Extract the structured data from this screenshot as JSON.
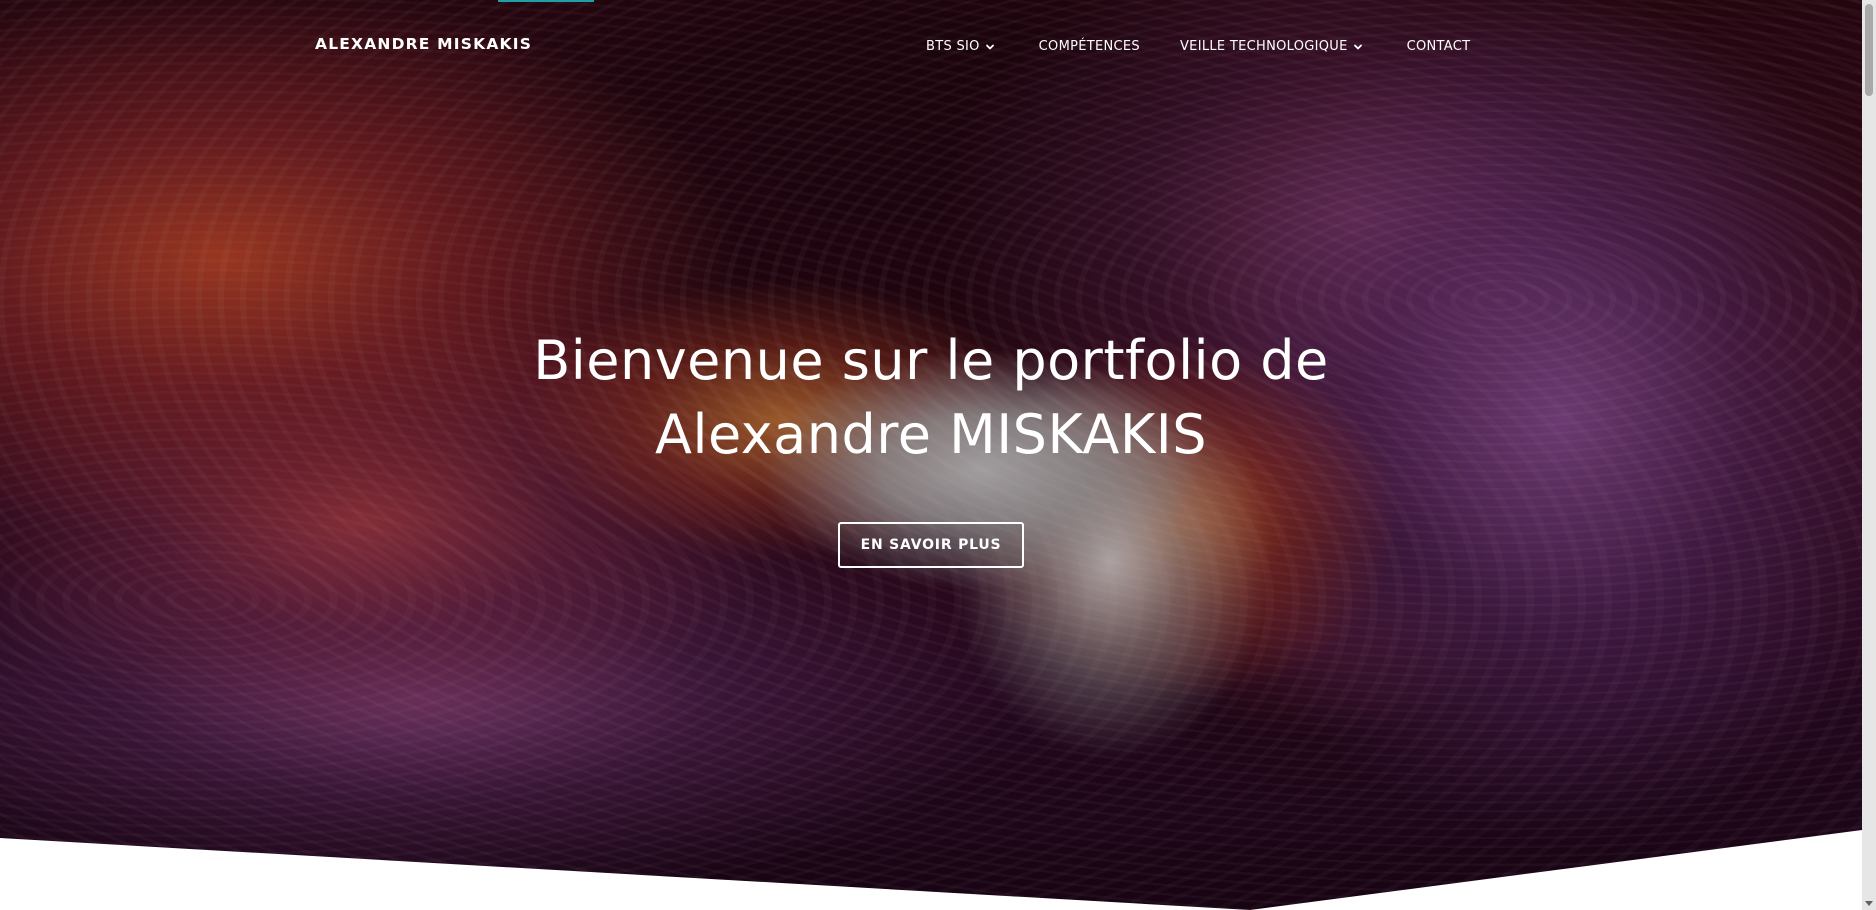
{
  "colors": {
    "hero_text": "#ffffff",
    "section_bg": "#ffffff",
    "accent_line": "#1fa0a8"
  },
  "navbar": {
    "brand": "ALEXANDRE MISKAKIS",
    "items": [
      {
        "label": "BTS SIO",
        "has_dropdown": true,
        "icon": "chevron-down-icon"
      },
      {
        "label": "COMPÉTENCES",
        "has_dropdown": false
      },
      {
        "label": "VEILLE TECHNOLOGIQUE",
        "has_dropdown": true,
        "icon": "chevron-down-icon"
      },
      {
        "label": "CONTACT",
        "has_dropdown": false
      }
    ]
  },
  "hero": {
    "title_line1": "Bienvenue sur le portfolio de",
    "title_line2": "Alexandre MISKAKIS",
    "cta_label": "EN SAVOIR PLUS"
  }
}
